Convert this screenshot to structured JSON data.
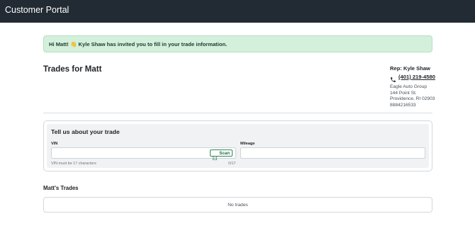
{
  "app": {
    "title": "Customer Portal"
  },
  "alert": {
    "text": "Hi Matt! 👋 Kyle Shaw has invited you to fill in your trade information."
  },
  "page": {
    "title": "Trades for Matt"
  },
  "rep": {
    "name": "Rep: Kyle Shaw",
    "phone": "(401) 219-4580",
    "phone_icon": "phone-icon",
    "address": [
      "Eagle Auto Group",
      "144 Point St.",
      "Providence, RI 02903",
      "8884216533"
    ]
  },
  "trade_form": {
    "title": "Tell us about your trade",
    "vin_label": "VIN",
    "vin_value": "",
    "vin_hint": "VIN must be 17 characters",
    "vin_count": "0/17",
    "scan_label": "Scan",
    "scan_icon": "barcode-scan-icon",
    "mileage_label": "Mileage",
    "mileage_value": ""
  },
  "trades": {
    "title": "Matt's Trades",
    "empty_text": "No trades"
  },
  "colors": {
    "header_bg": "#222b33",
    "alert_bg": "#d4f0dc",
    "accent": "#2e8b57"
  }
}
